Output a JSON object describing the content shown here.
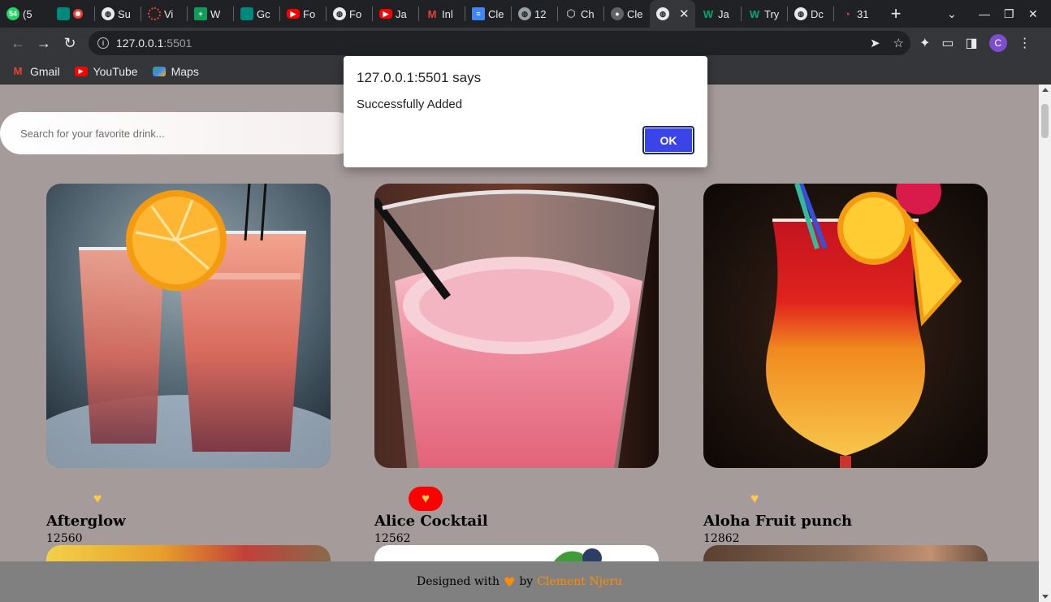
{
  "browser": {
    "tabs": [
      {
        "label": "(5",
        "favicon": "whatsapp-icon",
        "color": "#25d366",
        "badge": "54"
      },
      {
        "label": "",
        "favicon": "meet-icon",
        "color": "#00897b"
      },
      {
        "label": "Su",
        "favicon": "globe-icon",
        "color": "#5f6368"
      },
      {
        "label": "Vi",
        "favicon": "loading-icon",
        "color": "#ea4335"
      },
      {
        "label": "W",
        "favicon": "sheets-icon",
        "color": "#0f9d58"
      },
      {
        "label": "Gc",
        "favicon": "meet-icon",
        "color": "#00897b"
      },
      {
        "label": "Fo",
        "favicon": "youtube-icon",
        "color": "#ff0000"
      },
      {
        "label": "Fo",
        "favicon": "globe-icon",
        "color": "#5f6368"
      },
      {
        "label": "Ja",
        "favicon": "youtube-icon",
        "color": "#ff0000"
      },
      {
        "label": "Inl",
        "favicon": "gmail-icon",
        "color": "#ea4335"
      },
      {
        "label": "Cle",
        "favicon": "docs-icon",
        "color": "#4285f4"
      },
      {
        "label": "12",
        "favicon": "globe-icon",
        "color": "#5f6368"
      },
      {
        "label": "Ch",
        "favicon": "cube-icon",
        "color": "#9aa0a6"
      },
      {
        "label": "Cle",
        "favicon": "github-icon",
        "color": "#24292e"
      },
      {
        "label": "",
        "favicon": "globe-icon",
        "color": "#5f6368",
        "active": true
      },
      {
        "label": "Ja",
        "favicon": "w-icon",
        "color": "#04aa6d"
      },
      {
        "label": "Try",
        "favicon": "w-icon",
        "color": "#04aa6d"
      },
      {
        "label": "Dc",
        "favicon": "globe-icon",
        "color": "#5f6368"
      },
      {
        "label": "31",
        "favicon": "rss-icon",
        "color": "#ea4335"
      }
    ],
    "url_host": "127.0.0.1",
    "url_port": ":5501",
    "profile_initial": "C",
    "bookmarks": [
      {
        "label": "Gmail",
        "icon": "gmail-icon",
        "color": "#ea4335"
      },
      {
        "label": "YouTube",
        "icon": "youtube-icon",
        "color": "#ff0000"
      },
      {
        "label": "Maps",
        "icon": "maps-icon",
        "color": "#34a853"
      }
    ]
  },
  "page": {
    "search_placeholder": "Search for your favorite drink...",
    "drinks": [
      {
        "name": "Afterglow",
        "id": "12560",
        "favorited": false
      },
      {
        "name": "Alice Cocktail",
        "id": "12562",
        "favorited": true
      },
      {
        "name": "Aloha Fruit punch",
        "id": "12862",
        "favorited": false
      }
    ],
    "footer": {
      "text_before": "Designed with",
      "text_by": "by",
      "author": "Clement Njeru"
    }
  },
  "dialog": {
    "title": "127.0.0.1:5501 says",
    "message": "Successfully Added",
    "ok_label": "OK"
  }
}
